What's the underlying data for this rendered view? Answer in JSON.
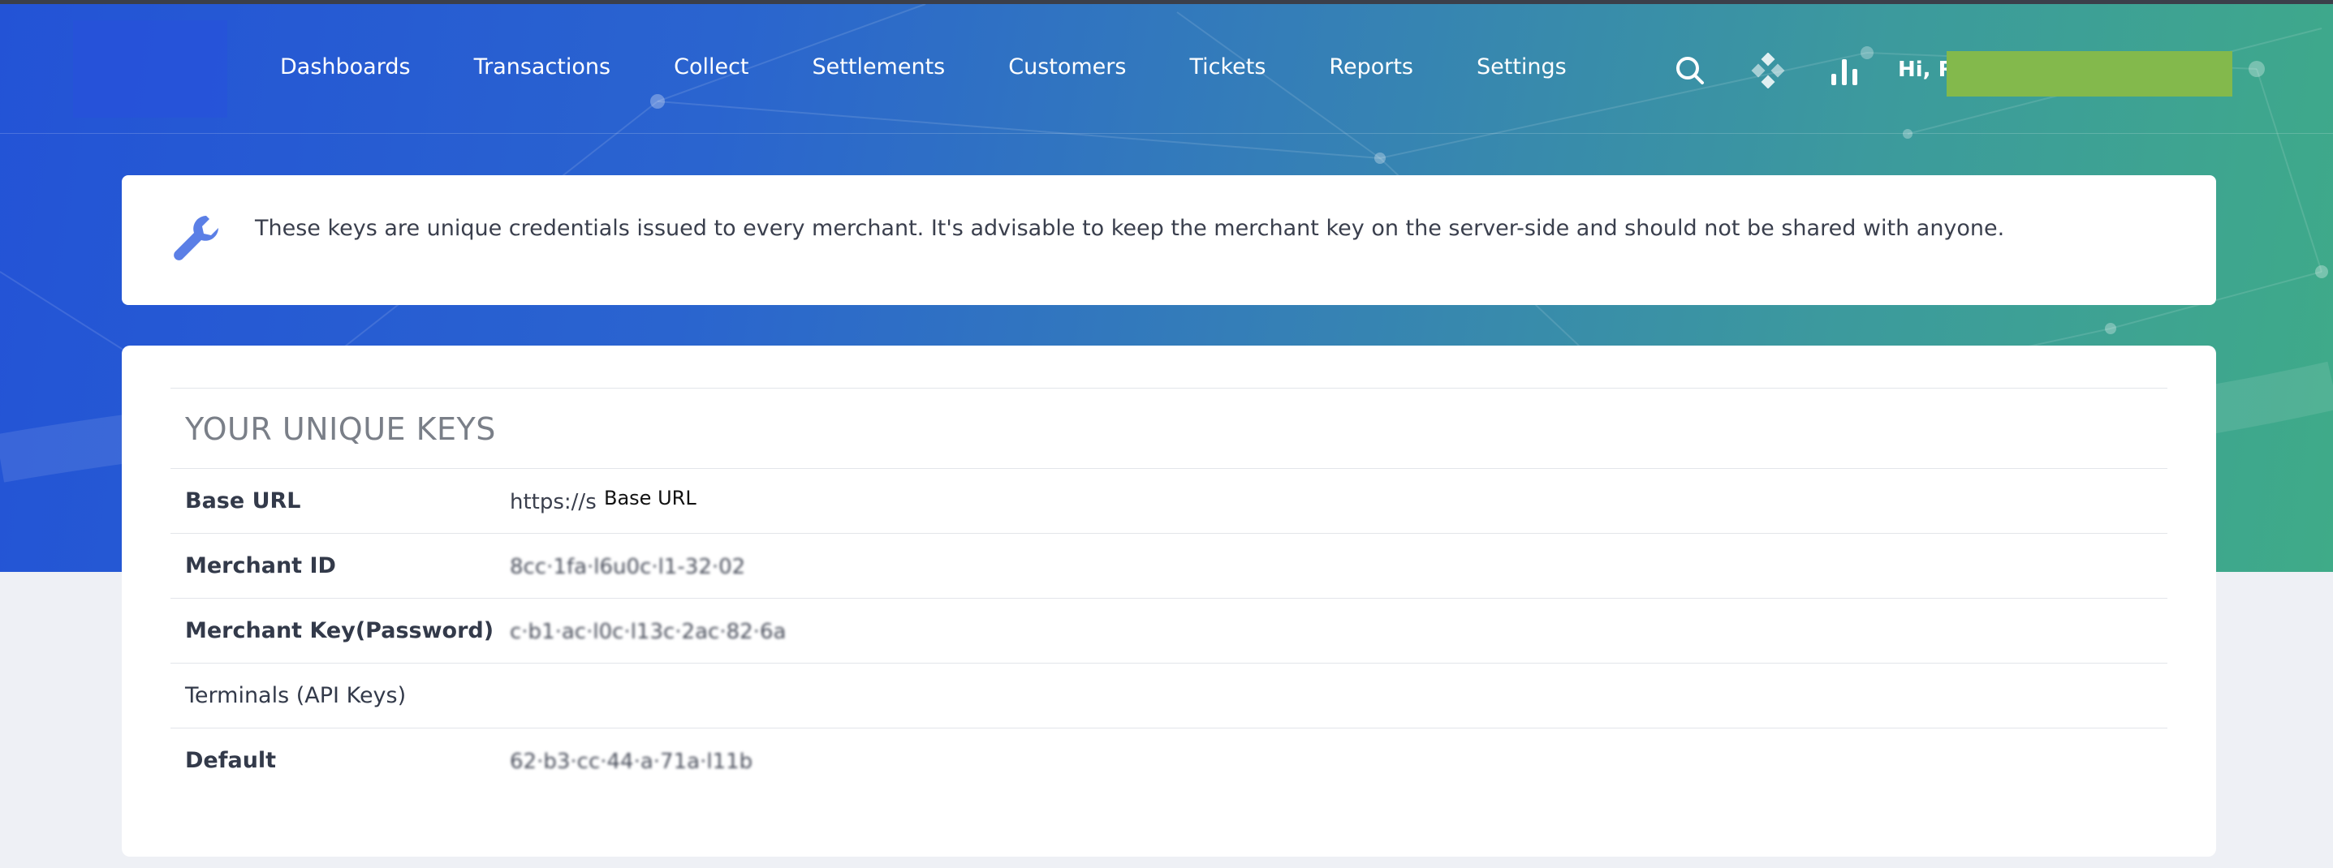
{
  "nav": {
    "items": [
      {
        "label": "Dashboards",
        "id": "dashboards"
      },
      {
        "label": "Transactions",
        "id": "transactions"
      },
      {
        "label": "Collect",
        "id": "collect"
      },
      {
        "label": "Settlements",
        "id": "settlements"
      },
      {
        "label": "Customers",
        "id": "customers"
      },
      {
        "label": "Tickets",
        "id": "tickets"
      },
      {
        "label": "Reports",
        "id": "reports"
      },
      {
        "label": "Settings",
        "id": "settings"
      }
    ],
    "icons": [
      "search-icon",
      "diamond-grid-icon",
      "bar-chart-icon"
    ],
    "greeting": "Hi, RA"
  },
  "info": {
    "text": "These keys are unique credentials issued to every merchant. It's advisable to keep the merchant key on the server-side and should not be shared with anyone."
  },
  "keys": {
    "title": "YOUR UNIQUE KEYS",
    "rows": [
      {
        "label": "Base URL",
        "value": "https://s",
        "tooltip": "Base URL"
      },
      {
        "label": "Merchant ID",
        "value": "8cc·1fa·l6u0c·l1-32·02"
      },
      {
        "label": "Merchant Key(Password)",
        "value": "c·b1·ac·l0c·l13c·2ac·82·6a"
      },
      {
        "label": "Terminals (API Keys)",
        "value": ""
      },
      {
        "label": "Default",
        "value": "62·b3·cc·44·a·71a·l11b"
      }
    ]
  },
  "colors": {
    "hero_start": "#2353d6",
    "hero_end": "#3fab88",
    "redact_green": "#83b94c",
    "accent_icon": "#5b7fe6"
  }
}
